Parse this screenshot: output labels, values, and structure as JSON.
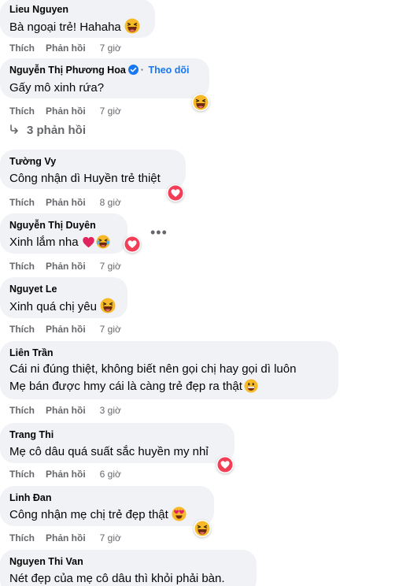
{
  "actions": {
    "like": "Thích",
    "reply": "Phản hồi"
  },
  "comments": [
    {
      "author": "Lieu Nguyen",
      "text": "Bà ngoại trẻ! Hahaha",
      "time": "7 giờ",
      "inline_emoji": "laughing-emoji"
    },
    {
      "author": "Nguyễn Thị Phương Hoa",
      "follow_label": "Theo dõi",
      "separator": "·",
      "text": "Gấy mô xinh rứa?",
      "time": "7 giờ",
      "reaction": "haha",
      "verified": true
    },
    {
      "author": "Tường Vy",
      "text": "Công nhận dì Huyền trẻ thiệt",
      "time": "8 giờ",
      "reaction": "love"
    },
    {
      "author": "Nguyễn Thị Duyên",
      "text": "Xinh lắm nha",
      "time": "7 giờ",
      "reaction": "love",
      "inline_emoji": [
        "red-heart-emoji",
        "tears-of-joy-emoji"
      ]
    },
    {
      "author": "Nguyet Le",
      "text": "Xinh quá chị yêu",
      "time": "7 giờ",
      "inline_emoji": "laughing-emoji"
    },
    {
      "author": "Liên Trần",
      "text_line1": "Cái ni đúng thiệt, không biết nên gọi chị hay gọi dì luôn",
      "text_line2": "Mẹ bán được hmy cái là càng trẻ đẹp ra thật",
      "time": "3 giờ",
      "inline_emoji": "grinning-emoji"
    },
    {
      "author": "Trang Thi",
      "text": "Mẹ cô dâu quá suất sắc huyền my nhỉ",
      "time": "6 giờ",
      "reaction": "love"
    },
    {
      "author": "Linh Đan",
      "text": "Công nhận mẹ chị trẻ đẹp thật",
      "time": "7 giờ",
      "reaction": "haha",
      "inline_emoji": "heart-eyes-emoji"
    },
    {
      "author": "Nguyen Thi Van",
      "text": "Nét đẹp của mẹ cô dâu thì khỏi phải bàn."
    }
  ],
  "replies": {
    "label": "3 phản hồi"
  },
  "colors": {
    "bubble": "#f0f2f5",
    "meta": "#65676b",
    "link": "#1877f2",
    "love": "#f33e58",
    "haha": "#f7b928"
  }
}
